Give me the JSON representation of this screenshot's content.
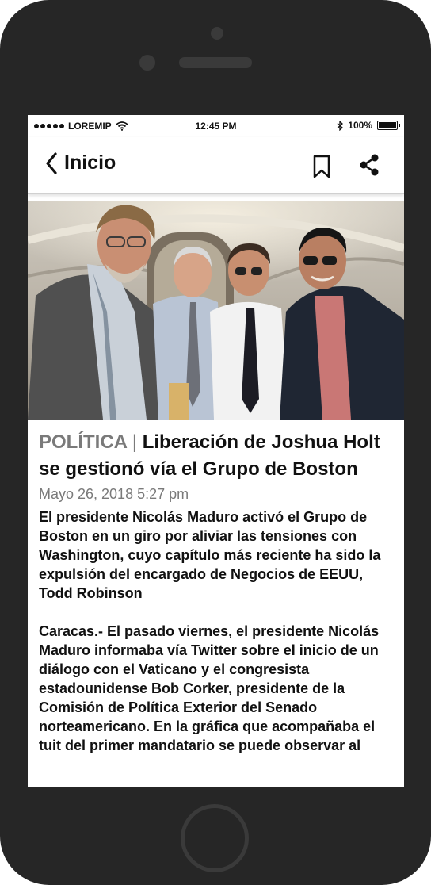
{
  "device": {
    "frame_color": "#262626",
    "detail_color": "#3a3a3a"
  },
  "status_bar": {
    "carrier": "LOREMIP",
    "time": "12:45 PM",
    "battery": "100%",
    "icons": [
      "signal-dots-icon",
      "wifi-icon",
      "bluetooth-icon",
      "battery-icon"
    ]
  },
  "nav": {
    "back_label": "Inicio",
    "icons": [
      "chevron-left-icon",
      "bookmark-icon",
      "share-icon"
    ]
  },
  "hero_image": {
    "description_icon": "photo-icon"
  },
  "article": {
    "category": "POLÍTICA",
    "separator": "|",
    "title": "Liberación de Joshua Holt se gestionó vía el Grupo de Boston",
    "date": "Mayo 26, 2018 5:27 pm",
    "lede": "El presidente Nicolás Maduro activó el Grupo de Boston en un giro por aliviar las tensiones con Washington, cuyo capítulo más reciente ha sido la expulsión del encargado de Negocios de EEUU, Todd Robinson",
    "body": "Caracas.- El pasado viernes, el presidente Nicolás Maduro informaba vía Twitter sobre el inicio de un diálogo con el Vaticano y el congresista estadounidense Bob Corker, presidente de la Comisión de Política Exterior del Senado norteamericano. En la gráfica que acompañaba el tuit del primer mandatario se puede observar al"
  },
  "colors": {
    "category": "#7a7a7a",
    "text": "#111111",
    "date": "#7a7a7a"
  }
}
